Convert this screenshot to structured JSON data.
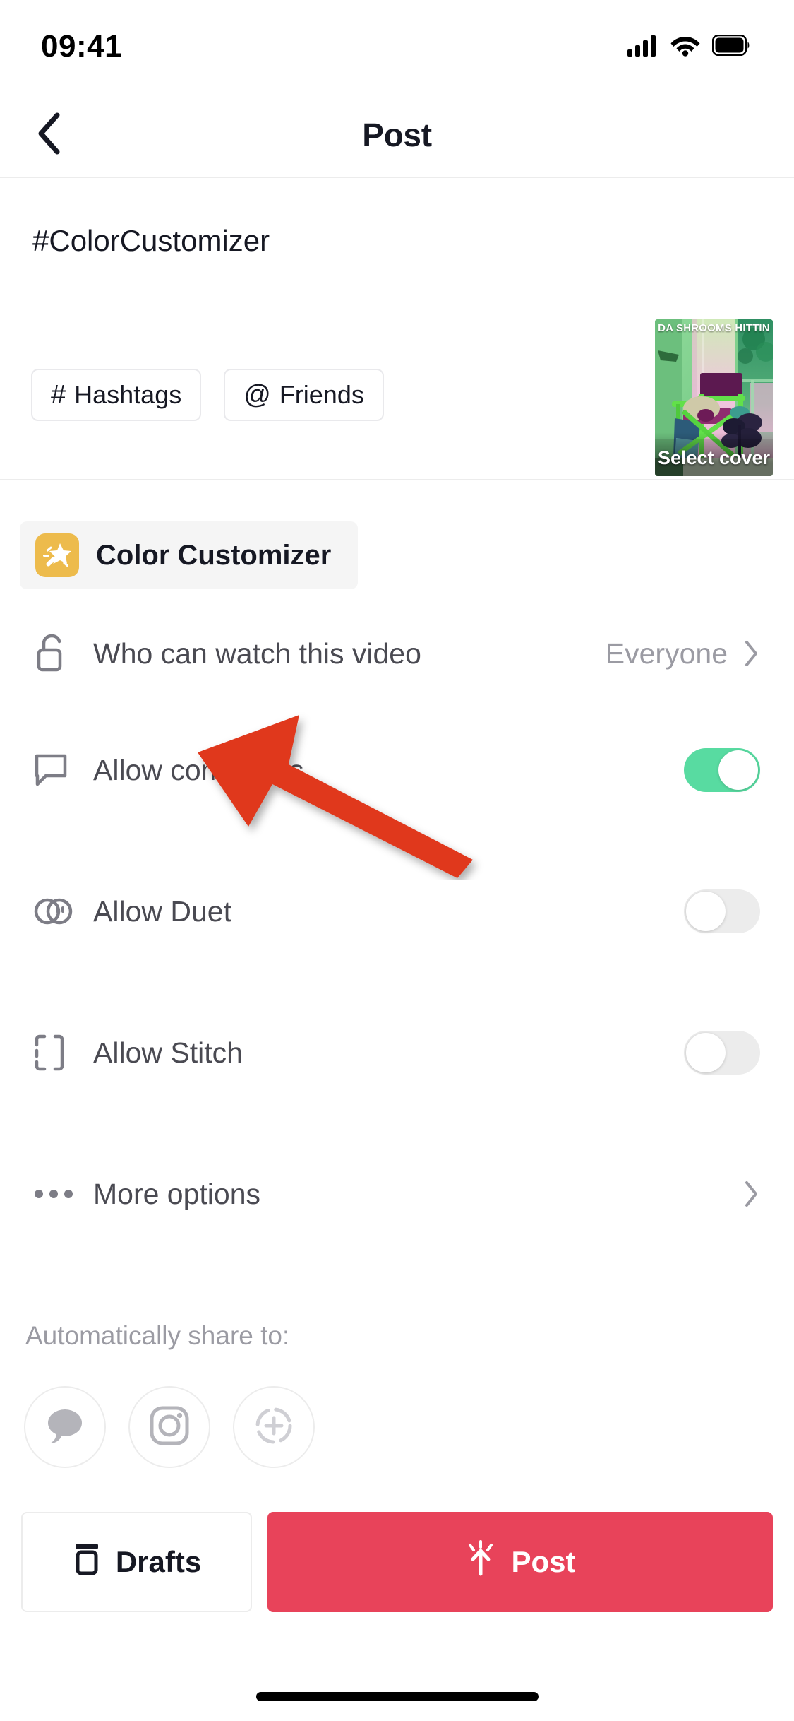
{
  "statusbar": {
    "time": "09:41",
    "signal_icon": "cellular-signal-icon",
    "wifi_icon": "wifi-icon",
    "battery_icon": "battery-icon"
  },
  "header": {
    "title": "Post",
    "back_icon": "chevron-left-icon"
  },
  "caption": {
    "text": "#ColorCustomizer",
    "chips": [
      {
        "glyph": "#",
        "label": "Hashtags",
        "icon_name": "hashtag-icon"
      },
      {
        "glyph": "@",
        "label": "Friends",
        "icon_name": "at-mention-icon"
      }
    ]
  },
  "cover": {
    "overlay_text": "DA SHROOMS HITTIN",
    "select_label": "Select cover"
  },
  "effect": {
    "name": "Color Customizer",
    "icon_name": "magic-wand-sparkle-icon",
    "icon_color": "#edbb4c"
  },
  "settings": {
    "privacy": {
      "label": "Who can watch this video",
      "value": "Everyone",
      "icon_name": "unlock-icon"
    },
    "toggles": [
      {
        "label": "Allow comments",
        "icon_name": "comment-bubble-icon",
        "state": "on"
      },
      {
        "label": "Allow Duet",
        "icon_name": "duet-circles-icon",
        "state": "off"
      },
      {
        "label": "Allow Stitch",
        "icon_name": "stitch-brackets-icon",
        "state": "off"
      }
    ],
    "more_options": {
      "label": "More options",
      "icon_name": "ellipsis-icon"
    }
  },
  "annotation": {
    "arrow_color": "#e0391f",
    "arrow_name": "red-pointer-arrow"
  },
  "share": {
    "label": "Automatically share to:",
    "targets": [
      {
        "icon_name": "messages-bubble-icon"
      },
      {
        "icon_name": "instagram-icon"
      },
      {
        "icon_name": "add-more-dashed-plus-icon"
      }
    ]
  },
  "bottom": {
    "drafts_label": "Drafts",
    "drafts_icon": "archive-box-icon",
    "post_label": "Post",
    "post_icon": "upload-sparkle-arrow-icon",
    "post_color": "#e8435a"
  },
  "colors": {
    "toggle_on": "#58dba1",
    "toggle_off": "#ececec",
    "text_primary": "#161823",
    "text_secondary": "#9b9ba3"
  }
}
